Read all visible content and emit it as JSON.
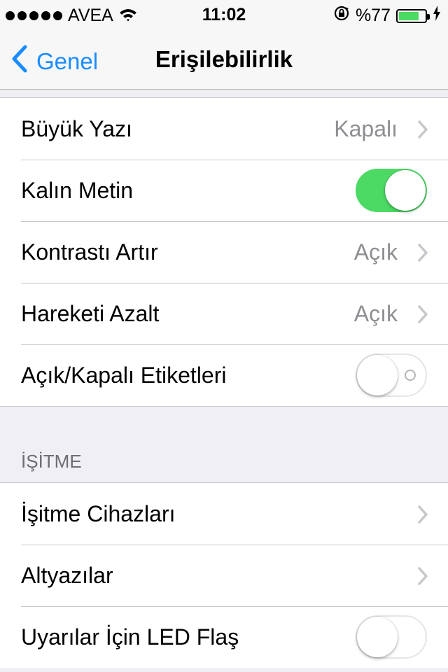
{
  "status": {
    "carrier": "AVEA",
    "time": "11:02",
    "battery": "%77",
    "battery_level": 0.77
  },
  "nav": {
    "back_label": "Genel",
    "title": "Erişilebilirlik"
  },
  "vision": {
    "items": [
      {
        "label": "Büyük Yazı",
        "value": "Kapalı"
      },
      {
        "label": "Kalın Metin",
        "toggle": "on"
      },
      {
        "label": "Kontrastı Artır",
        "value": "Açık"
      },
      {
        "label": "Hareketi Azalt",
        "value": "Açık"
      },
      {
        "label": "Açık/Kapalı Etiketleri",
        "toggle": "off"
      }
    ]
  },
  "hearing": {
    "header": "İŞİTME",
    "items": [
      {
        "label": "İşitme Cihazları"
      },
      {
        "label": "Altyazılar"
      },
      {
        "label": "Uyarılar İçin LED Flaş",
        "toggle": "off"
      }
    ]
  },
  "icons": [
    "signal-dots-icon",
    "wifi-icon",
    "rotation-lock-icon",
    "battery-icon",
    "charging-bolt-icon",
    "chevron-left-icon",
    "chevron-right-icon"
  ],
  "colors": {
    "accent": "#1a8cff",
    "toggle_on": "#4cd964",
    "secondary_text": "#8e8e93",
    "background": "#efeff4"
  }
}
